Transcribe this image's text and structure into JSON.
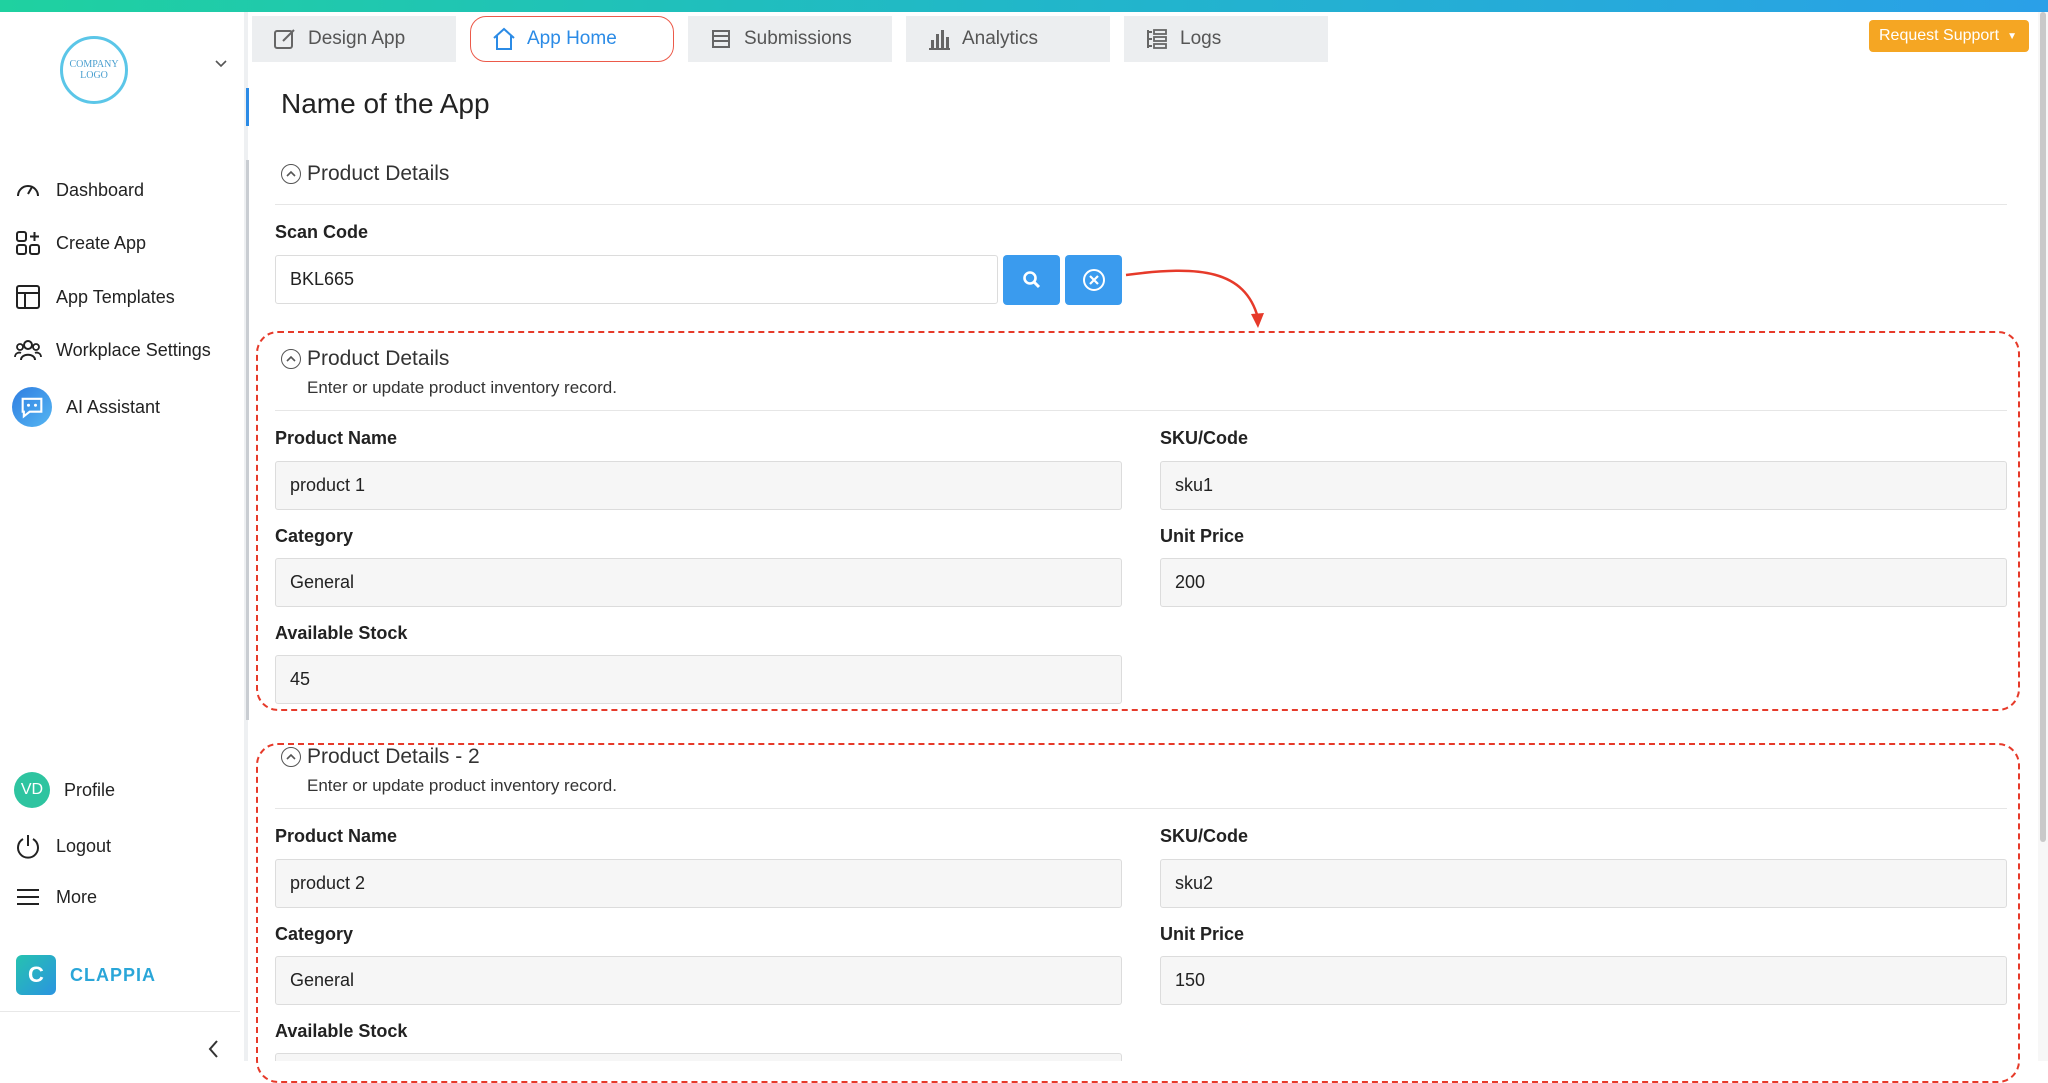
{
  "sidebar": {
    "logo_text": "COMPANY LOGO",
    "items": [
      {
        "label": "Dashboard",
        "icon": "gauge-icon"
      },
      {
        "label": "Create App",
        "icon": "grid-plus-icon"
      },
      {
        "label": "App Templates",
        "icon": "template-icon"
      },
      {
        "label": "Workplace Settings",
        "icon": "users-icon"
      },
      {
        "label": "AI Assistant",
        "icon": "ai-chat-icon"
      }
    ],
    "bottom": [
      {
        "label": "Profile",
        "avatar": "VD"
      },
      {
        "label": "Logout",
        "icon": "power-icon"
      },
      {
        "label": "More",
        "icon": "menu-icon"
      }
    ],
    "brand": "CLAPPIA"
  },
  "tabs": [
    {
      "label": "Design App",
      "icon": "edit-icon"
    },
    {
      "label": "App Home",
      "icon": "home-icon",
      "active": true
    },
    {
      "label": "Submissions",
      "icon": "list-icon"
    },
    {
      "label": "Analytics",
      "icon": "bar-chart-icon"
    },
    {
      "label": "Logs",
      "icon": "logs-icon"
    }
  ],
  "request_support": "Request Support",
  "app_title": "Name of the App",
  "section_top": {
    "title": "Product Details",
    "scan_label": "Scan Code",
    "scan_value": "BKL665"
  },
  "section1": {
    "title": "Product Details",
    "description": "Enter or update product inventory record.",
    "fields": {
      "product_name_label": "Product Name",
      "product_name": "product 1",
      "sku_label": "SKU/Code",
      "sku": "sku1",
      "category_label": "Category",
      "category": "General",
      "price_label": "Unit Price",
      "price": "200",
      "stock_label": "Available Stock",
      "stock": "45"
    }
  },
  "section2": {
    "title": "Product Details - 2",
    "description": "Enter or update product inventory record.",
    "fields": {
      "product_name_label": "Product Name",
      "product_name": "product 2",
      "sku_label": "SKU/Code",
      "sku": "sku2",
      "category_label": "Category",
      "category": "General",
      "price_label": "Unit Price",
      "price": "150",
      "stock_label": "Available Stock"
    }
  },
  "colors": {
    "accent": "#2b8be6",
    "annotation": "#e63a2a",
    "support": "#f5a623"
  }
}
